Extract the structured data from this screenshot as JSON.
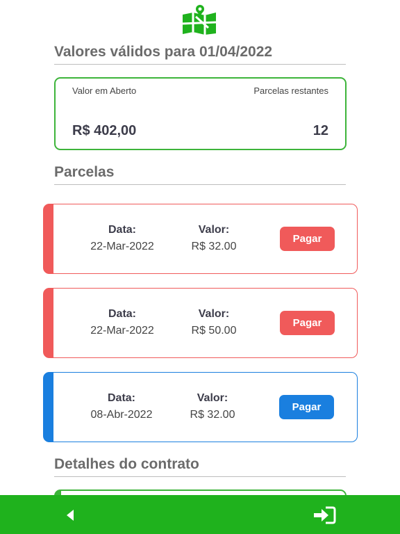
{
  "brand": {
    "logo_icon": "map-pin-logo-icon",
    "color": "#1fb21d"
  },
  "header": {
    "title": "Valores válidos para 01/04/2022"
  },
  "summary": {
    "open_value_label": "Valor em Aberto",
    "open_value": "R$ 402,00",
    "remaining_label": "Parcelas restantes",
    "remaining": "12"
  },
  "installments_section": {
    "title": "Parcelas"
  },
  "installments": [
    {
      "date_label": "Data:",
      "date": "22-Mar-2022",
      "value_label": "Valor:",
      "value": "R$ 32.00",
      "pay_label": "Pagar",
      "status": "overdue",
      "color": "#f05a5a"
    },
    {
      "date_label": "Data:",
      "date": "22-Mar-2022",
      "value_label": "Valor:",
      "value": "R$ 50.00",
      "pay_label": "Pagar",
      "status": "overdue",
      "color": "#f05a5a"
    },
    {
      "date_label": "Data:",
      "date": "08-Abr-2022",
      "value_label": "Valor:",
      "value": "R$ 32.00",
      "pay_label": "Pagar",
      "status": "upcoming",
      "color": "#1a7fdf"
    }
  ],
  "details_section": {
    "title": "Detalhes do contrato"
  },
  "bottom_nav": {
    "back_icon": "back-arrow-icon",
    "login_icon": "sign-in-icon"
  }
}
